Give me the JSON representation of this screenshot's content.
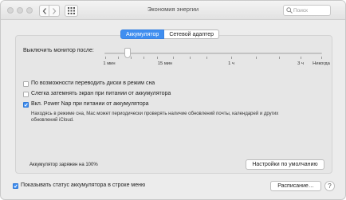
{
  "window": {
    "title": "Экономия энергии",
    "search_placeholder": "Поиск"
  },
  "tabs": [
    {
      "label": "Аккумулятор",
      "active": true
    },
    {
      "label": "Сетевой адаптер",
      "active": false
    }
  ],
  "monitor_slider": {
    "label": "Выключить монитор после:",
    "value": "1 мин",
    "ticks": [
      "1 мин",
      "15 мин",
      "1 ч",
      "3 ч",
      "Никогда"
    ]
  },
  "options": [
    {
      "label": "По возможности переводить диски в режим сна",
      "checked": false
    },
    {
      "label": "Слегка затемнять экран при питании от аккумулятора",
      "checked": false
    },
    {
      "label": "Вкл. Power Nap при питании от аккумулятора",
      "checked": true
    }
  ],
  "power_nap_note": "Находясь в режиме сна, Mac может периодически проверять наличие обновлений почты, календарей и других обновлений iCloud.",
  "battery_status": "Аккумулятор заряжен на 100%",
  "defaults_button": "Настройки по умолчанию",
  "show_status": {
    "label": "Показывать статус аккумулятора в строке меню",
    "checked": true
  },
  "schedule_button": "Расписание…",
  "colors": {
    "accent": "#3f8ef0",
    "window_bg": "#ececec"
  }
}
